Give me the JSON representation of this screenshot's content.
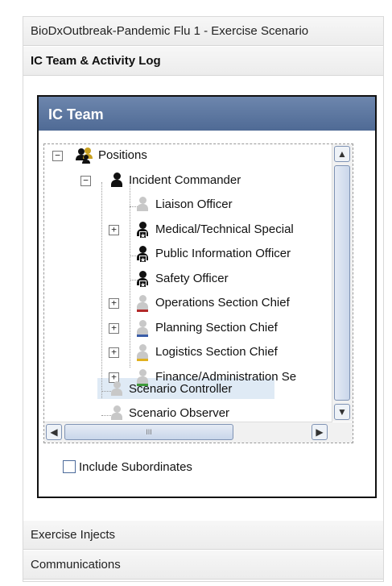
{
  "accordion": {
    "sections": [
      {
        "label": "BioDxOutbreak-Pandemic Flu 1 - Exercise Scenario"
      },
      {
        "label": "IC Team & Activity Log"
      },
      {
        "label": "Exercise Injects"
      },
      {
        "label": "Communications"
      }
    ]
  },
  "panel": {
    "title": "IC Team"
  },
  "tree": {
    "root": {
      "label": "Positions",
      "expander": "−"
    },
    "commander": {
      "label": "Incident Commander",
      "expander": "−"
    },
    "items": [
      {
        "label": "Liaison Officer",
        "expander": "",
        "icon": "grey",
        "band": ""
      },
      {
        "label": "Medical/Technical Special",
        "expander": "+",
        "icon": "dark-star",
        "band": ""
      },
      {
        "label": "Public Information Officer",
        "expander": "",
        "icon": "dark-star",
        "band": ""
      },
      {
        "label": "Safety Officer",
        "expander": "",
        "icon": "dark-star",
        "band": ""
      },
      {
        "label": "Operations Section Chief",
        "expander": "+",
        "icon": "grey",
        "band": "#b22a2a"
      },
      {
        "label": "Planning Section Chief",
        "expander": "+",
        "icon": "grey",
        "band": "#3a5da8"
      },
      {
        "label": "Logistics Section Chief",
        "expander": "+",
        "icon": "grey",
        "band": "#e0b020"
      },
      {
        "label": "Finance/Administration Se",
        "expander": "+",
        "icon": "grey",
        "band": "#3e9a3a"
      }
    ],
    "controller": {
      "label": "Scenario Controller"
    },
    "observer": {
      "label": "Scenario Observer"
    },
    "hscroll_grip": "III"
  },
  "options": {
    "include_subordinates_label": "Include Subordinates",
    "include_subordinates_checked": false
  },
  "colors": {
    "title_bar": "#5a75a0",
    "selection": "#dfeaf5"
  },
  "icons": {
    "expanded": "minus-box-icon",
    "collapsed": "plus-box-icon",
    "group": "people-group-icon",
    "person": "person-icon"
  }
}
